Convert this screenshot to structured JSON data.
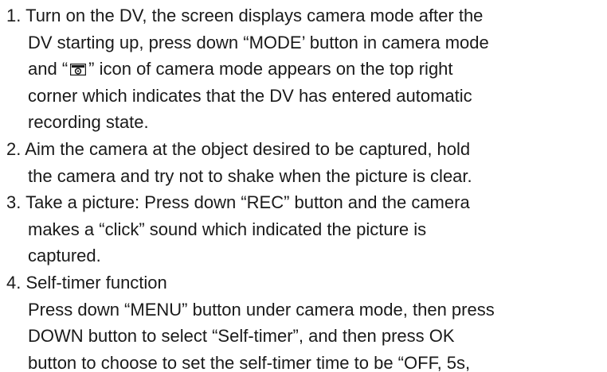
{
  "steps": [
    {
      "number": "1.",
      "lines": [
        "Turn on the DV, the screen displays camera mode after the",
        "DV starting up, press down “MODE’ button in camera mode",
        "and “",
        "” icon of camera mode appears on the top right",
        "corner which indicates that the DV has entered automatic",
        "recording state."
      ],
      "icon": "camera-mode-icon"
    },
    {
      "number": "2.",
      "lines": [
        "Aim the camera at the object desired to be captured, hold",
        "the camera and try not to shake when the picture is clear."
      ]
    },
    {
      "number": "3.",
      "lines": [
        "Take a picture: Press down “REC” button and the camera",
        "makes a “click” sound which indicated the picture is",
        "captured."
      ]
    },
    {
      "number": "4.",
      "lines": [
        "Self-timer function",
        "Press down “MENU” button under camera mode, then press",
        "DOWN button to select “Self-timer”, and then press OK",
        "button to choose to set the self-timer time to be “OFF, 5s,"
      ]
    }
  ]
}
